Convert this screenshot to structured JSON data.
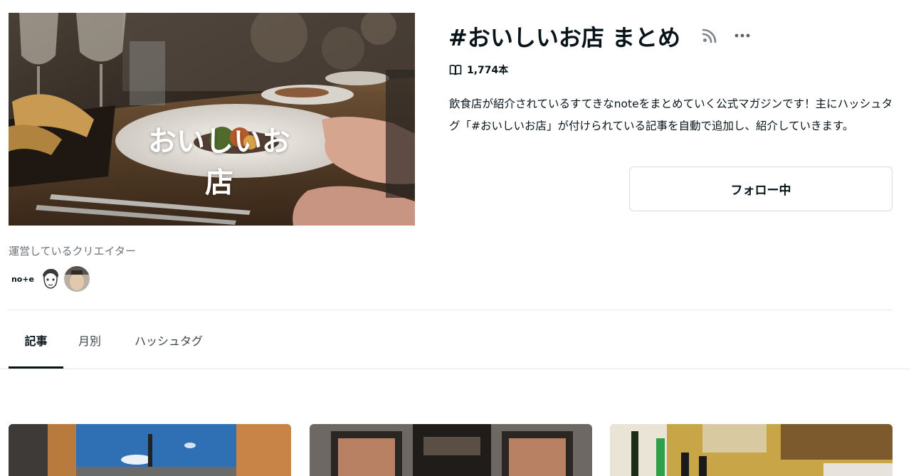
{
  "magazine": {
    "title": "#おいしいお店 まとめ",
    "hero_text": "おいしいお店",
    "article_count": "1,774本",
    "description": "飲食店が紹介されているすてきなnoteをまとめていく公式マガジンです！主にハッシュタグ「#おいしいお店」が付けられている記事を自動で追加し、紹介していきます。",
    "follow_label": "フォロー中"
  },
  "creators": {
    "label": "運営しているクリエイター",
    "items": [
      {
        "name": "note",
        "avatar_text": "no+e"
      },
      {
        "name": "illustrated-face"
      },
      {
        "name": "photo"
      }
    ]
  },
  "tabs": [
    {
      "label": "記事",
      "active": true
    },
    {
      "label": "月別",
      "active": false
    },
    {
      "label": "ハッシュタグ",
      "active": false
    }
  ],
  "icons": {
    "rss": "rss-icon",
    "more": "more-dots-icon",
    "book": "book-icon"
  },
  "colors": {
    "text": "#08131a",
    "muted": "#6c7378",
    "border": "#d9dde0"
  }
}
